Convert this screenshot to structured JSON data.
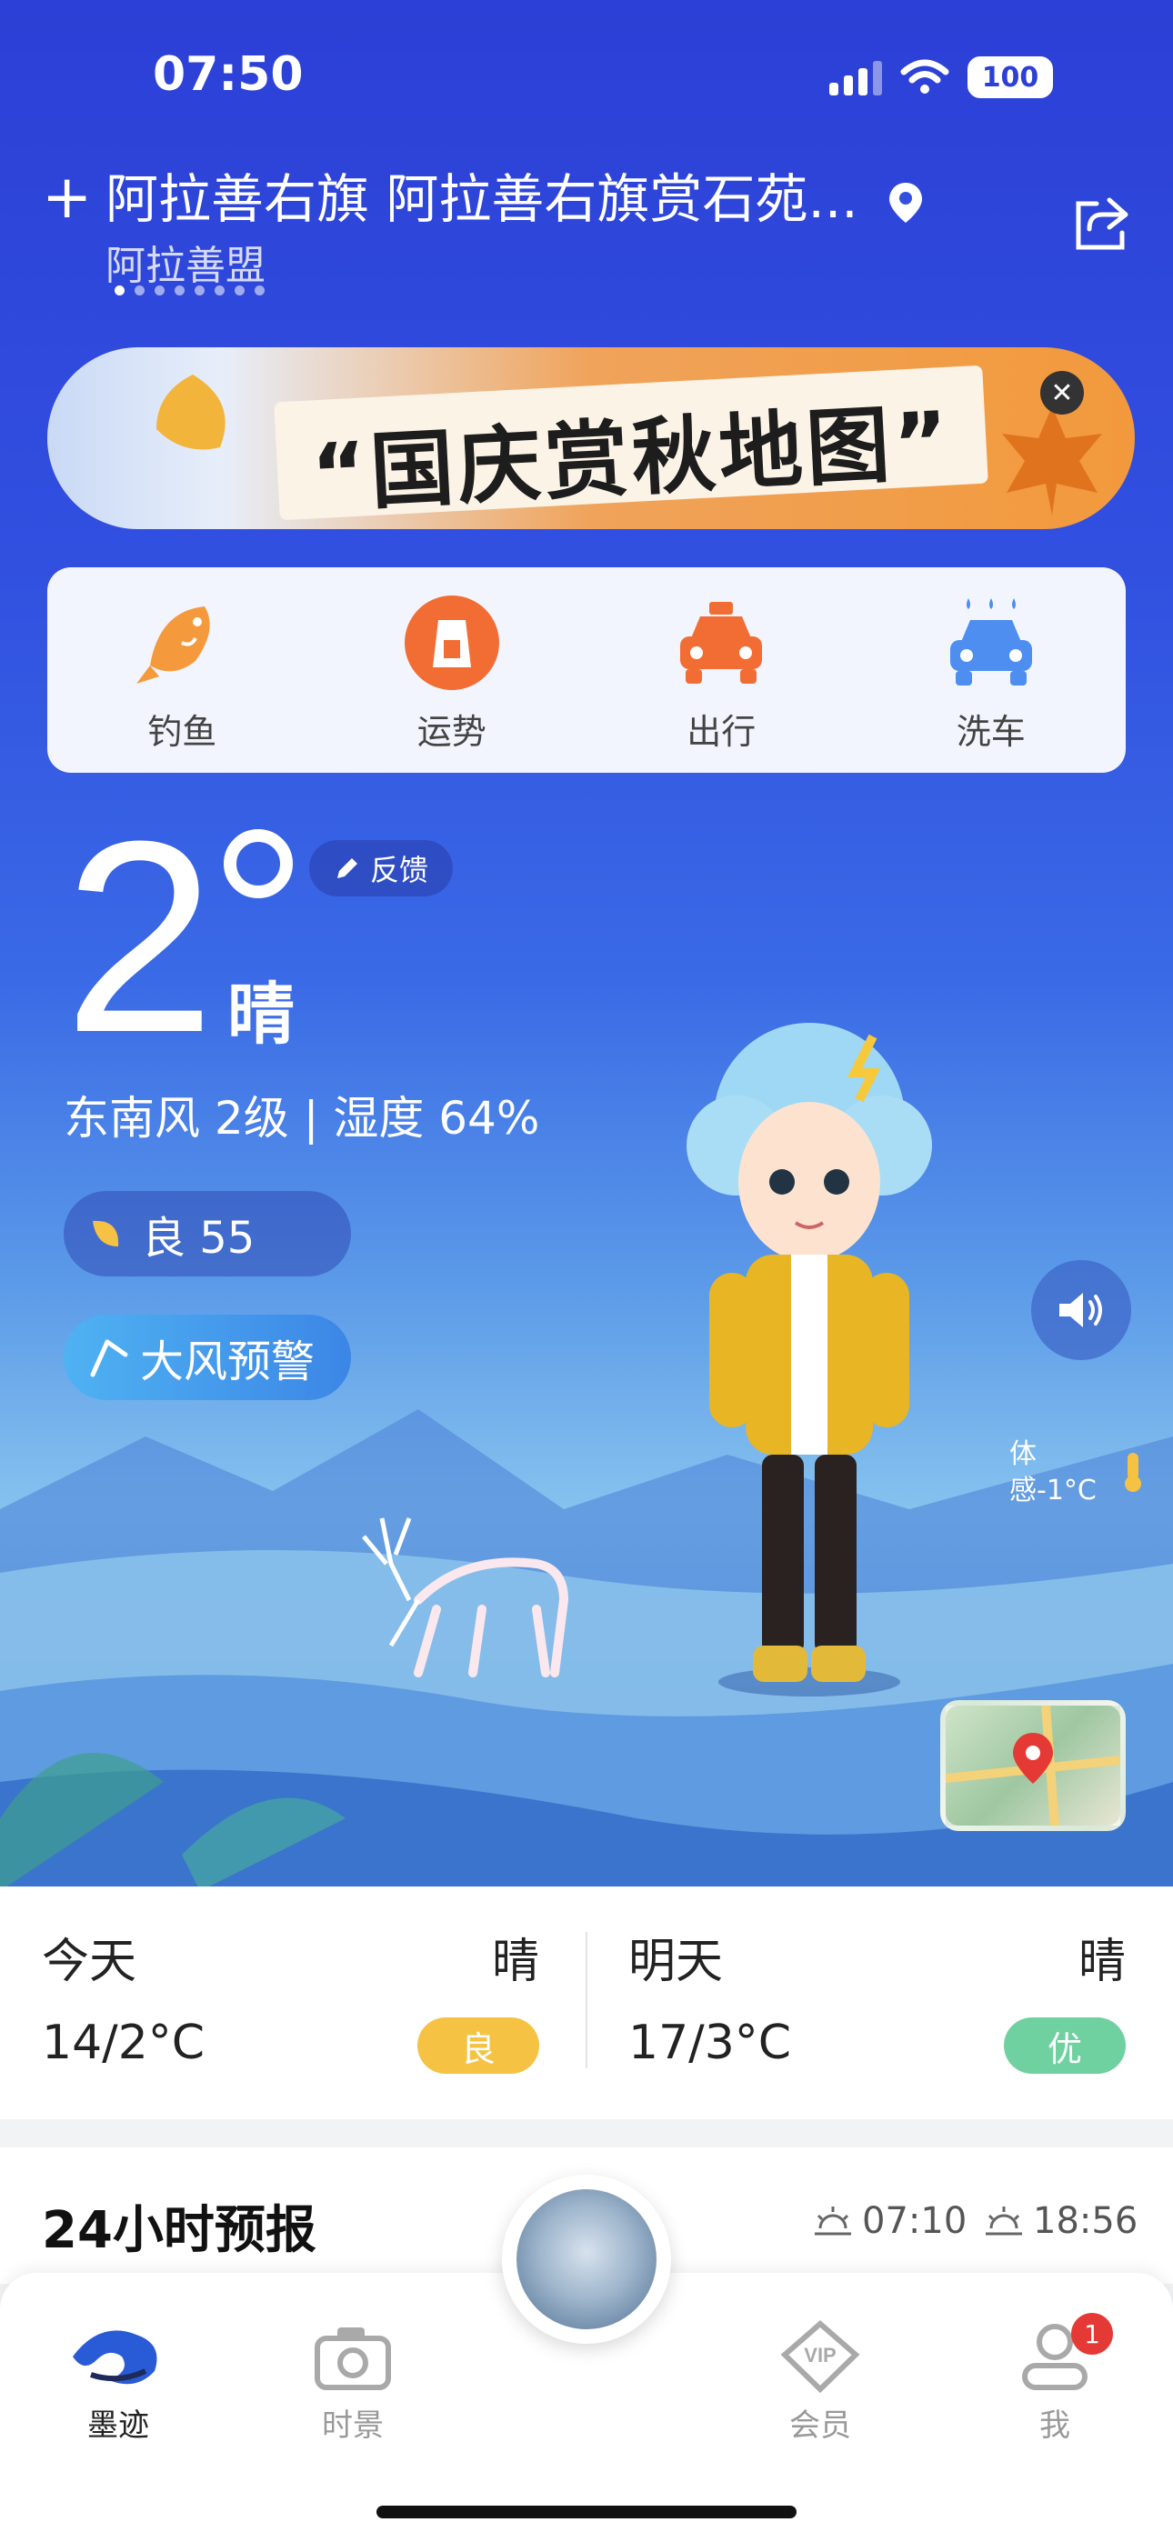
{
  "status_bar": {
    "time": "07:50",
    "battery": "100"
  },
  "location": {
    "title": "阿拉善右旗 阿拉善右旗赏石苑...",
    "subtitle": "阿拉善盟"
  },
  "banner": {
    "text": "“国庆赏秋地图”"
  },
  "quick_actions": [
    {
      "label": "钓鱼",
      "icon": "fish-icon",
      "color": "#f59a3c"
    },
    {
      "label": "运势",
      "icon": "fortune-icon",
      "color": "#f26d33"
    },
    {
      "label": "出行",
      "icon": "car-icon",
      "color": "#f26d33"
    },
    {
      "label": "洗车",
      "icon": "car-wash-icon",
      "color": "#4d8ef0"
    }
  ],
  "weather": {
    "temperature": "2",
    "condition": "晴",
    "feedback_label": "反馈",
    "wind_humidity": "东南风 2级 | 湿度 64%",
    "aqi": "良 55",
    "warning": "大风预警",
    "feels_like_line1": "体",
    "feels_like_line2": "感-1°C"
  },
  "days": [
    {
      "name": "今天",
      "condition": "晴",
      "temps": "14/2°C",
      "aqi": "良",
      "aqi_color": "#f5c243"
    },
    {
      "name": "明天",
      "condition": "晴",
      "temps": "17/3°C",
      "aqi": "优",
      "aqi_color": "#6fd0a0"
    }
  ],
  "forecast": {
    "title": "24小时预报",
    "sunrise": "07:10",
    "sunset": "18:56"
  },
  "tabs": [
    {
      "label": "墨迹",
      "icon": "moji-icon",
      "active": true
    },
    {
      "label": "时景",
      "icon": "camera-icon",
      "active": false
    },
    {
      "label": "会员",
      "icon": "vip-icon",
      "active": false
    },
    {
      "label": "我",
      "icon": "profile-icon",
      "active": false
    }
  ],
  "profile_badge": "1"
}
